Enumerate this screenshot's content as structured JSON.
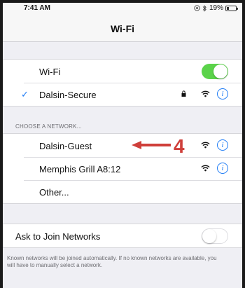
{
  "status_bar": {
    "time": "7:41 AM",
    "battery": "19%",
    "location_icon": "location-icon",
    "bluetooth_icon": "bluetooth-icon"
  },
  "nav": {
    "title": "Wi-Fi"
  },
  "wifi_group": {
    "wifi_label": "Wi-Fi",
    "wifi_on": true,
    "connected_network": "Dalsin-Secure"
  },
  "networks": {
    "header": "CHOOSE A NETWORK...",
    "items": [
      {
        "name": "Dalsin-Guest",
        "locked": false
      },
      {
        "name": "Memphis Grill A8:12",
        "locked": false
      }
    ],
    "other": "Other..."
  },
  "annotation": {
    "number": "4",
    "color": "#cf3f3a"
  },
  "ask_join": {
    "label": "Ask to Join Networks",
    "enabled": false,
    "note": "Known networks will be joined automatically. If no known networks are available, you will have to manually select a network."
  },
  "colors": {
    "accent": "#1f7cf5",
    "toggle_on": "#5bd34a"
  }
}
